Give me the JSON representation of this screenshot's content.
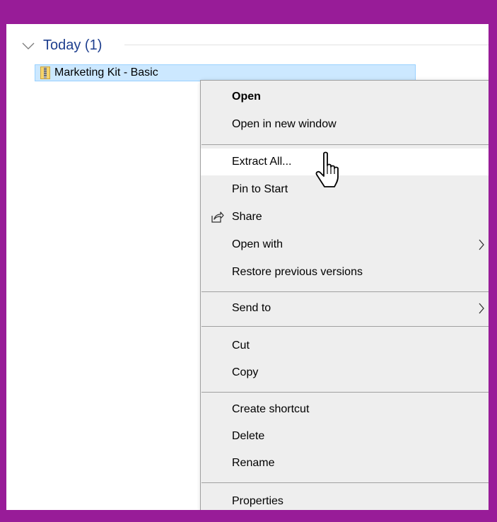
{
  "group": {
    "title": "Today (1)"
  },
  "file": {
    "name": "Marketing Kit - Basic",
    "icon": "zip-folder-icon"
  },
  "context_menu": {
    "items": [
      {
        "label": "Open",
        "bold": true
      },
      {
        "label": "Open in new window"
      },
      {
        "label": "Extract All...",
        "hover": true
      },
      {
        "label": "Pin to Start"
      },
      {
        "label": "Share",
        "icon": "share-icon"
      },
      {
        "label": "Open with",
        "submenu": true
      },
      {
        "label": "Restore previous versions"
      },
      {
        "label": "Send to",
        "submenu": true
      },
      {
        "label": "Cut"
      },
      {
        "label": "Copy"
      },
      {
        "label": "Create shortcut"
      },
      {
        "label": "Delete"
      },
      {
        "label": "Rename"
      },
      {
        "label": "Properties"
      }
    ]
  },
  "colors": {
    "border": "#981c98",
    "selection": "#cce8ff",
    "header_text": "#1e3f8f",
    "menu_bg": "#eeeeee"
  },
  "cursor": "hand-pointer-icon"
}
